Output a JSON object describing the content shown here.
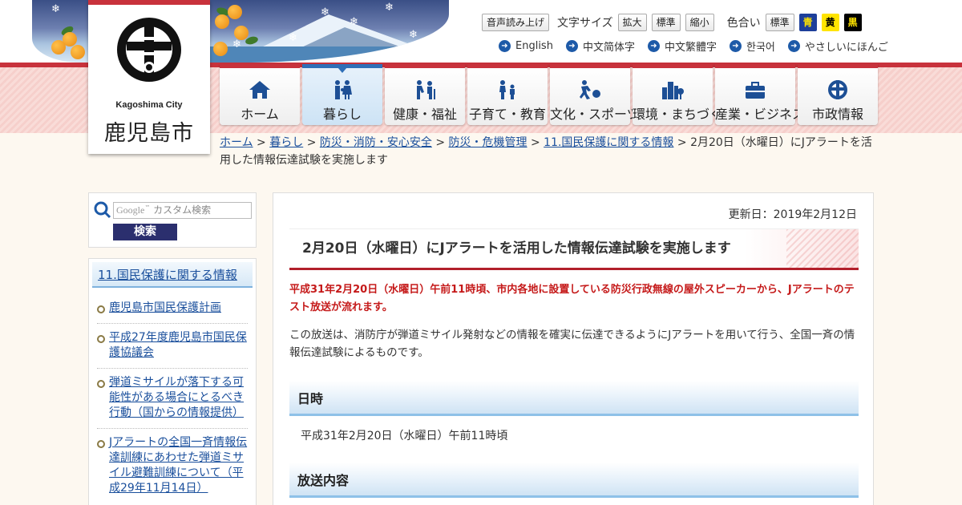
{
  "site": {
    "name_en": "Kagoshima City",
    "name_jp": "鹿児島市"
  },
  "utility": {
    "voice_label": "音声読み上げ",
    "font_size_label": "文字サイズ",
    "font_enlarge": "拡大",
    "font_standard": "標準",
    "font_shrink": "縮小",
    "color_label": "色合い",
    "color_standard": "標準",
    "color_blue": "青",
    "color_yellow": "黄",
    "color_black": "黒"
  },
  "languages": [
    {
      "label": "English"
    },
    {
      "label": "中文简体字"
    },
    {
      "label": "中文繁體字"
    },
    {
      "label": "한국어"
    },
    {
      "label": "やさしいにほんご"
    }
  ],
  "nav": [
    {
      "label": "ホーム",
      "icon": "home-icon"
    },
    {
      "label": "暮らし",
      "icon": "family-icon"
    },
    {
      "label": "健康・福祉",
      "icon": "health-welfare-icon"
    },
    {
      "label": "子育て・教育",
      "icon": "parenting-icon"
    },
    {
      "label": "文化・スポーツ",
      "icon": "sports-icon"
    },
    {
      "label": "環境・まちづくり",
      "icon": "city-icon"
    },
    {
      "label": "産業・ビジネス",
      "icon": "briefcase-icon"
    },
    {
      "label": "市政情報",
      "icon": "city-emblem-icon"
    }
  ],
  "breadcrumb": {
    "links": [
      "ホーム",
      "暮らし",
      "防災・消防・安心安全",
      "防災・危機管理",
      "11.国民保護に関する情報"
    ],
    "separator": ">",
    "current": "2月20日（水曜日）にJアラートを活用した情報伝達試験を実施します"
  },
  "search": {
    "placeholder": "カスタム検索",
    "google_label": "Google",
    "button": "検索"
  },
  "sidebar": {
    "heading": "11.国民保護に関する情報",
    "items": [
      {
        "label": "鹿児島市国民保護計画"
      },
      {
        "label": "平成27年度鹿児島市国民保護協議会"
      },
      {
        "label": "弾道ミサイルが落下する可能性がある場合にとるべき行動（国からの情報提供）"
      },
      {
        "label": "Jアラートの全国一斉情報伝達訓練にあわせた弾道ミサイル避難訓練について（平成29年11月14日）"
      }
    ]
  },
  "article": {
    "updated": "更新日：2019年2月12日",
    "title": "2月20日（水曜日）にJアラートを活用した情報伝達試験を実施します",
    "lead": "平成31年2月20日（水曜日）午前11時頃、市内各地に設置している防災行政無線の屋外スピーカーから、Jアラートのテスト放送が流れます。",
    "body": "この放送は、消防庁が弾道ミサイル発射などの情報を確実に伝達できるようにJアラートを用いて行う、全国一斉の情報伝達試験によるものです。",
    "section1_heading": "日時",
    "section1_text": "平成31年2月20日（水曜日）午前11時頃",
    "section2_heading": "放送内容"
  },
  "colors": {
    "brand_red": "#c8323c",
    "link_blue": "#1a4f9c",
    "alert_red": "#c51a1a",
    "search_button": "#2b2f6e",
    "color_blue_bg": "#1d3f9a",
    "color_yellow_bg": "#ffe400",
    "color_black_bg": "#000000"
  }
}
